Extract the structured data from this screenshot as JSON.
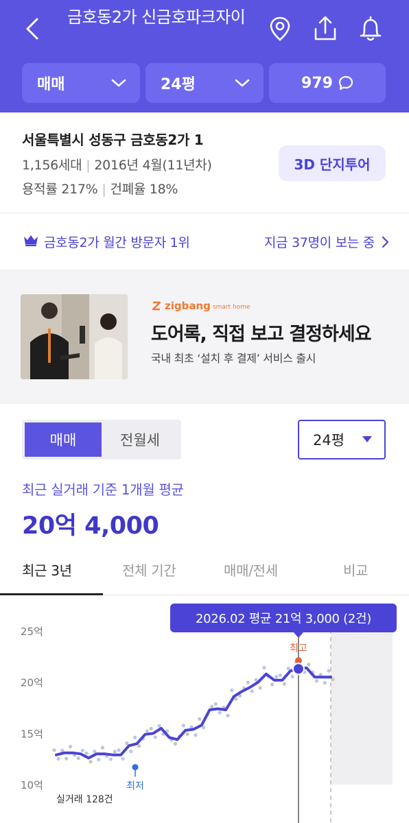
{
  "header": {
    "title": "금호동2가 신금호파크자이",
    "filters": {
      "trade": "매매",
      "area": "24평",
      "comment_count": "979"
    },
    "colors": {
      "brand": "#5b54e0",
      "accent": "#4a43d6"
    }
  },
  "info": {
    "address": "서울특별시 성동구 금호동2가 1",
    "households": "1,156세대",
    "built": "2016년 4월(11년차)",
    "floor_area_ratio": "용적률 217%",
    "building_coverage": "건폐율 18%",
    "tour_button": "3D 단지투어"
  },
  "visitor": {
    "rank": "금호동2가 월간 방문자 1위",
    "viewing": "지금 37명이 보는 중"
  },
  "ad": {
    "brand": "zigbang",
    "brand_sub": "smart home",
    "title": "도어록, 직접 보고 결정하세요",
    "subtitle": "국내 최초 ‘설치 후 결제’ 서비스 출시"
  },
  "price_section": {
    "segment": {
      "active": "매매",
      "inactive": "전월세"
    },
    "area_select": "24평",
    "basis": "최근 실거래 기준 1개월 평균",
    "price": "20억 4,000"
  },
  "tabs": [
    "최근 3년",
    "전체 기간",
    "매매/전세",
    "비교"
  ],
  "chart": {
    "tooltip": "2026.02 평균 21억 3,000 (2건)",
    "max_label": "최고",
    "min_label": "최저",
    "trade_count": "실거래 128건"
  },
  "chart_data": {
    "type": "line",
    "ylabel": "",
    "y_tick_labels": [
      "25억",
      "20억",
      "15억",
      "10억"
    ],
    "y_ticks": [
      25,
      20,
      15,
      10
    ],
    "ylim": [
      10,
      25
    ],
    "series": [
      {
        "values": [
          12.9,
          13.1,
          13.1,
          13.0,
          12.6,
          13.0,
          13.0,
          12.9,
          12.9,
          13.8,
          14.0,
          14.9,
          15.0,
          15.5,
          14.6,
          14.4,
          15.3,
          15.4,
          15.8,
          17.3,
          17.4,
          17.3,
          18.6,
          19.1,
          19.5,
          20.0,
          20.8,
          20.2,
          20.2,
          21.1,
          21.3,
          21.4,
          20.5,
          20.5,
          20.5
        ]
      }
    ],
    "max_value": 22.1,
    "min_value": 11.7,
    "selected_value": 21.3
  }
}
